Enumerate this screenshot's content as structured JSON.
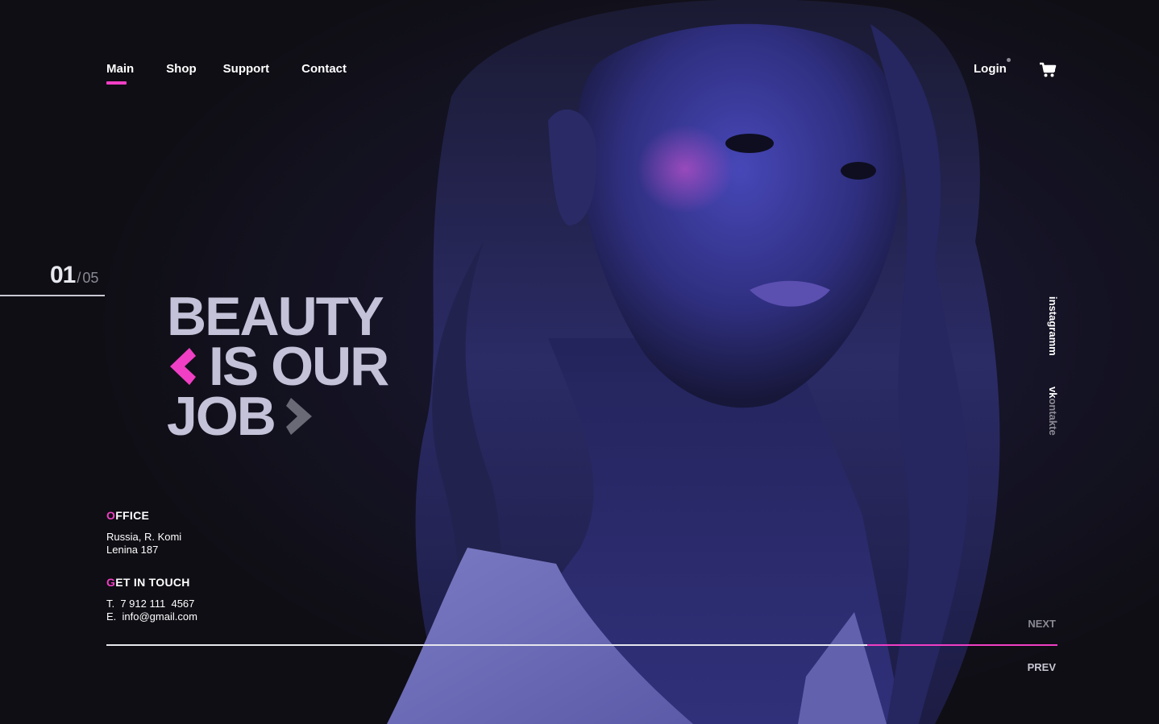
{
  "nav": {
    "items": [
      {
        "label": "Main",
        "active": true
      },
      {
        "label": "Shop",
        "active": false
      },
      {
        "label": "Support",
        "active": false
      },
      {
        "label": "Contact",
        "active": false
      }
    ],
    "login_label": "Login",
    "cart_icon": "cart-icon"
  },
  "slider": {
    "current": "01",
    "separator": "/",
    "total": "05",
    "next_label": "NEXT",
    "prev_label": "PREV",
    "progress": 0.2
  },
  "headline": {
    "line1": "BEAUTY",
    "line2": "IS OUR",
    "line3": "JOB"
  },
  "office": {
    "heading_first": "O",
    "heading_rest": "FFICE",
    "address_line1": "Russia, R. Komi",
    "address_line2": "Lenina 187"
  },
  "contact": {
    "heading_first": "G",
    "heading_rest": "ET IN TOUCH",
    "phone": "T.  7 912 111  4567",
    "email": "E.  info@gmail.com"
  },
  "social": {
    "instagram": "instagramm",
    "vk_prefix": "vk",
    "vk_rest": "ontakte"
  },
  "colors": {
    "accent": "#f03fc4",
    "background": "#0f0e14",
    "headline": "#c4c2d8",
    "photo_tint": "#3a3a9a"
  }
}
